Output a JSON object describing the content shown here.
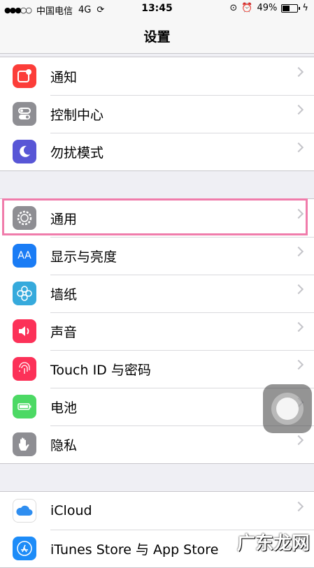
{
  "status_bar": {
    "signal": "●●●○○",
    "carrier": "中国电信",
    "network": "4G",
    "sync_icon": "sync-icon",
    "time": "13:45",
    "battery_percent": "49%",
    "battery_level": 0.49
  },
  "nav": {
    "title": "设置"
  },
  "groups": [
    {
      "items": [
        {
          "label": "通知",
          "icon": "notifications-icon",
          "color": "#fc3d39"
        },
        {
          "label": "控制中心",
          "icon": "control-center-icon",
          "color": "#8e8e93"
        },
        {
          "label": "勿扰模式",
          "icon": "moon-icon",
          "color": "#5856d6"
        }
      ]
    },
    {
      "items": [
        {
          "label": "通用",
          "icon": "gear-icon",
          "color": "#8e8e93",
          "highlighted": true
        },
        {
          "label": "显示与亮度",
          "icon": "display-icon",
          "color": "#1a7cf5",
          "glyph": "AA"
        },
        {
          "label": "墙纸",
          "icon": "wallpaper-icon",
          "color": "#36aadc"
        },
        {
          "label": "声音",
          "icon": "sound-icon",
          "color": "#fc3158"
        },
        {
          "label": "Touch ID 与密码",
          "icon": "fingerprint-icon",
          "color": "#fc3158"
        },
        {
          "label": "电池",
          "icon": "battery-icon",
          "color": "#4cd964"
        },
        {
          "label": "隐私",
          "icon": "hand-icon",
          "color": "#8e8e93"
        }
      ]
    },
    {
      "items": [
        {
          "label": "iCloud",
          "icon": "cloud-icon",
          "color": "#ffffff"
        },
        {
          "label": "iTunes Store 与 App Store",
          "icon": "app-store-icon",
          "color": "#1d8cf8"
        }
      ]
    }
  ],
  "watermark": "广东龙网",
  "highlight_color": "#f07cab"
}
